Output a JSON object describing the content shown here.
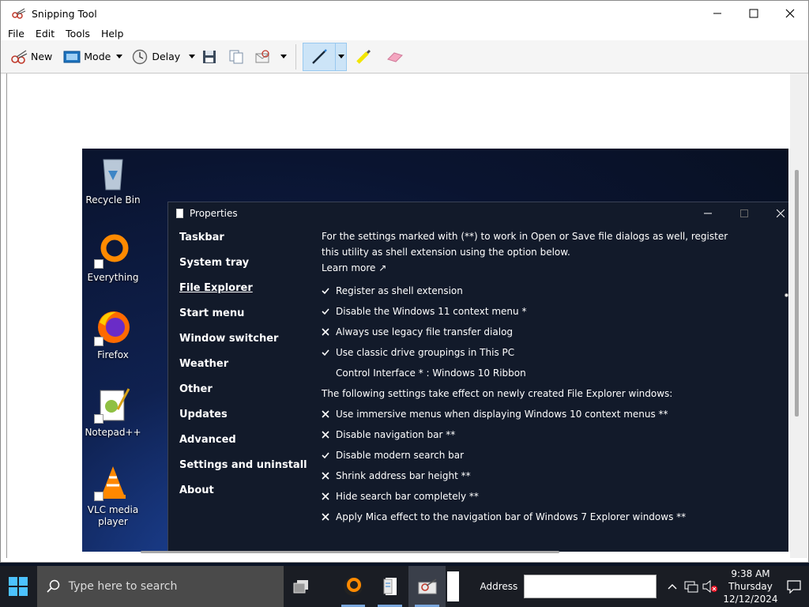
{
  "window": {
    "title": "Snipping Tool",
    "menu": [
      "File",
      "Edit",
      "Tools",
      "Help"
    ],
    "toolbar": {
      "new_label": "New",
      "mode_label": "Mode",
      "delay_label": "Delay"
    }
  },
  "desktop": {
    "icons": [
      {
        "label": "Recycle Bin",
        "icon": "recycle-bin-icon"
      },
      {
        "label": "Everything",
        "icon": "everything-icon"
      },
      {
        "label": "Firefox",
        "icon": "firefox-icon"
      },
      {
        "label": "Notepad++",
        "icon": "notepadpp-icon"
      },
      {
        "label": "VLC media player",
        "icon": "vlc-icon"
      }
    ]
  },
  "properties": {
    "title": "Properties",
    "nav": [
      "Taskbar",
      "System tray",
      "File Explorer",
      "Start menu",
      "Window switcher",
      "Weather",
      "Other",
      "Updates",
      "Advanced",
      "Settings and uninstall",
      "About"
    ],
    "active_nav": "File Explorer",
    "intro": "For the settings marked with (**) to work in Open or Save file dialogs as well, register this utility as shell extension using the option below.",
    "learn_more": "Learn more ↗",
    "options": [
      {
        "mark": "check",
        "text": "Register as shell extension"
      },
      {
        "mark": "check",
        "text": "Disable the Windows 11 context menu *"
      },
      {
        "mark": "cross",
        "text": "Always use legacy file transfer dialog"
      },
      {
        "mark": "check",
        "text": "Use classic drive groupings in This PC"
      },
      {
        "mark": "none",
        "text": "Control Interface * : Windows 10 Ribbon"
      }
    ],
    "note": "The following settings take effect on newly created File Explorer windows:",
    "options2": [
      {
        "mark": "cross",
        "text": "Use immersive menus when displaying Windows 10 context menus **"
      },
      {
        "mark": "cross",
        "text": "Disable navigation bar **"
      },
      {
        "mark": "check",
        "text": "Disable modern search bar"
      },
      {
        "mark": "cross",
        "text": "Shrink address bar height **"
      },
      {
        "mark": "cross",
        "text": "Hide search bar completely **"
      },
      {
        "mark": "cross",
        "text": "Apply Mica effect to the navigation bar of Windows 7 Explorer windows **"
      }
    ]
  },
  "taskbar": {
    "search_placeholder": "Type here to search",
    "address_label": "Address",
    "clock": {
      "time": "9:38 AM",
      "day": "Thursday",
      "date": "12/12/2024"
    }
  },
  "colors": {
    "accent": "#0078d4",
    "taskbar": "#1a1d24",
    "properties_bg": "#121a2a"
  }
}
